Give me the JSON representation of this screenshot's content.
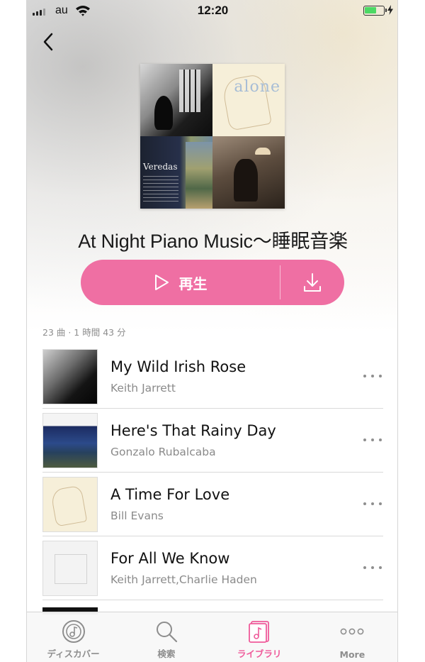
{
  "status_bar": {
    "carrier": "au",
    "time": "12:20",
    "battery_level": 0.65,
    "battery_color": "#4cd964"
  },
  "nav": {
    "back_icon": "chevron-left-icon"
  },
  "album": {
    "title": "At Night Piano Music～睡眠音楽",
    "cover_texts": {
      "alone": "alone",
      "veredas": "Veredas"
    },
    "play_label": "再生",
    "meta": "23 曲 · 1 時間 43 分"
  },
  "tracks": [
    {
      "title": "My Wild Irish Rose",
      "artist": "Keith Jarrett"
    },
    {
      "title": "Here's That Rainy Day",
      "artist": "Gonzalo Rubalcaba"
    },
    {
      "title": "A Time For Love",
      "artist": "Bill Evans"
    },
    {
      "title": "For All We Know",
      "artist": "Keith Jarrett,Charlie Haden"
    }
  ],
  "tabbar": {
    "items": [
      {
        "label": "ディスカバー",
        "icon": "discover-icon"
      },
      {
        "label": "検索",
        "icon": "search-icon"
      },
      {
        "label": "ライブラリ",
        "icon": "library-icon",
        "active": true
      },
      {
        "label": "More",
        "icon": "more-icon"
      }
    ]
  },
  "colors": {
    "accent": "#ef6fa3",
    "tab_active": "#ef5a9a",
    "secondary_text": "#8a8a8a"
  }
}
